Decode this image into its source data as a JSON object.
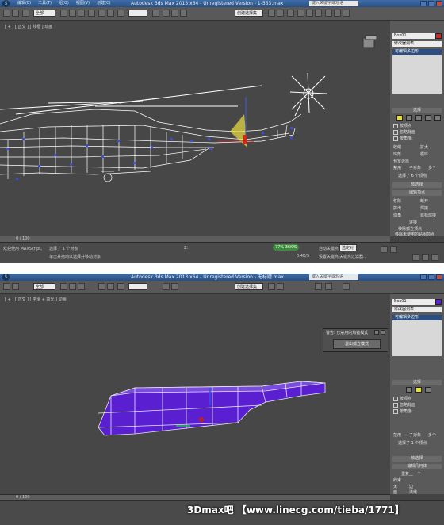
{
  "panel1": {
    "title": "Autodesk 3ds Max 2013 x64 - Unregistered Version - 1-553.max",
    "help_search": "键入关键字或短语",
    "menu": [
      "编辑(E)",
      "工具(T)",
      "组(G)",
      "视图(V)",
      "创建(C)",
      "修改器",
      "动画",
      "图形编辑器",
      "渲染(R)",
      "自定义(U)",
      "MAXScript(M)",
      "帮助(H)"
    ],
    "selection_filter": "全部",
    "named_selection": "创建选择集",
    "viewport_label": "[ + ] [ 正交 ] [ 线框 ] 动画",
    "object_name": "Box01",
    "modifier_list": "修改器列表",
    "modifier_selected": "可编辑多边形",
    "rollout_selection": "选择",
    "selection_options": [
      "按顶点",
      "忽略背面",
      "按角度:",
      "收缩",
      "扩大",
      "环形",
      "循环"
    ],
    "preview_selection": "预览选择",
    "preview_options": [
      "禁用",
      "子对象",
      "多个"
    ],
    "selected_count": "选择了 6 个顶点",
    "rollout_soft": "软选择",
    "rollout_edit": "编辑顶点",
    "edit_buttons": [
      "移除",
      "断开",
      "挤出",
      "焊接",
      "切角",
      "目标焊接",
      "连接",
      "移除孤立顶点",
      "移除未使用的贴图顶点"
    ],
    "weight_label": "权重:",
    "timeline": "0 / 100",
    "status_left": "欢迎使用 MAXScript。",
    "status_selected": "选择了 1 个对象",
    "status_hint": "单击并拖动以选择并移动对象",
    "autokey": "自动关键点",
    "set_key": "设置关键点",
    "key_filter": "选定对象",
    "keyfilters_label": "关键点过滤器...",
    "speed_badge": "36K/S",
    "speed_badge2": "0.4K/S",
    "percent": "77%",
    "coord_z": "Z:"
  },
  "panel2": {
    "title": "Autodesk 3ds Max 2013 x64 - Unregistered Version - 无标题.max",
    "help_search": "键入关键字或短语",
    "viewport_label": "[ + ] [ 正交 ] [ 平滑 + 高光 ] 动画",
    "dialog_title": "警告: 已禁用的热键模式",
    "dialog_button": "退出孤立模式",
    "object_name": "Box01",
    "modifier_list": "修改器列表",
    "modifier_selected": "可编辑多边形",
    "rollout_selection": "选择",
    "selection_options": [
      "按顶点",
      "忽略背面",
      "按角度:"
    ],
    "preview_options": [
      "禁用",
      "子对象",
      "多个"
    ],
    "selected_count": "选择了 1 个顶点",
    "rollout_soft": "软选择",
    "rollout_edit": "编辑几何体",
    "edit_items": [
      "重复上一个",
      "约束",
      "无",
      "边",
      "面",
      "法线"
    ],
    "timeline": "0 / 100"
  },
  "watermark": "3Dmax吧 【www.linecg.com/tieba/1771】",
  "colors": {
    "viewport_bg": "#474747",
    "wire": "#ffffff",
    "vertex": "#3d4fd8",
    "selected_vertex": "#e02020",
    "gizmo_yellow": "#ece040",
    "poly_fill": "#5a1fd0",
    "titlebar": "#2d5588",
    "accent": "#2c4e80"
  }
}
